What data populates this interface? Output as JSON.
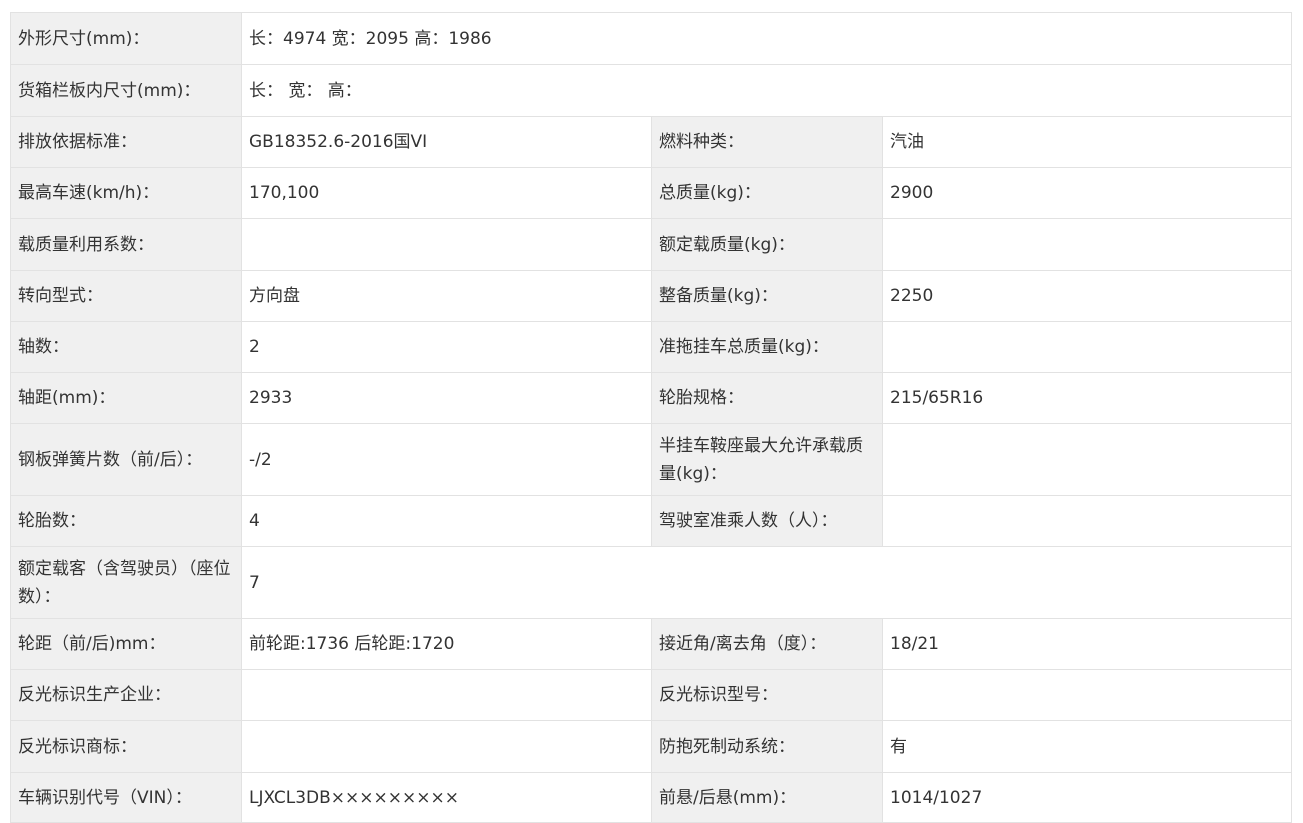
{
  "rows": [
    {
      "type": "wide",
      "label": "外形尺寸(mm)：",
      "value": "长：4974 宽：2095 高：1986"
    },
    {
      "type": "wide",
      "label": "货箱栏板内尺寸(mm)：",
      "value": "长： 宽： 高："
    },
    {
      "type": "pair",
      "label1": "排放依据标准：",
      "value1": "GB18352.6-2016国VI",
      "label2": "燃料种类：",
      "value2": "汽油"
    },
    {
      "type": "pair",
      "label1": "最高车速(km/h)：",
      "value1": "170,100",
      "label2": "总质量(kg)：",
      "value2": "2900"
    },
    {
      "type": "pair",
      "label1": "载质量利用系数：",
      "value1": "",
      "label2": "额定载质量(kg)：",
      "value2": ""
    },
    {
      "type": "pair",
      "label1": "转向型式：",
      "value1": "方向盘",
      "label2": "整备质量(kg)：",
      "value2": "2250"
    },
    {
      "type": "pair",
      "label1": "轴数：",
      "value1": "2",
      "label2": "准拖挂车总质量(kg)：",
      "value2": ""
    },
    {
      "type": "pair",
      "label1": "轴距(mm)：",
      "value1": "2933",
      "label2": "轮胎规格：",
      "value2": "215/65R16"
    },
    {
      "type": "pair",
      "tall": true,
      "label1": "钢板弹簧片数（前/后）：",
      "value1": "-/2",
      "label2": "半挂车鞍座最大允许承载质量(kg)：",
      "value2": ""
    },
    {
      "type": "pair",
      "label1": "轮胎数：",
      "value1": "4",
      "label2": "驾驶室准乘人数（人）：",
      "value2": ""
    },
    {
      "type": "wide",
      "tall": true,
      "label": "额定载客（含驾驶员）（座位数）：",
      "value": "7"
    },
    {
      "type": "pair",
      "label1": "轮距（前/后)mm：",
      "value1": "前轮距:1736 后轮距:1720",
      "label2": "接近角/离去角（度）：",
      "value2": "18/21"
    },
    {
      "type": "pair",
      "label1": "反光标识生产企业：",
      "value1": "",
      "label2": "反光标识型号：",
      "value2": ""
    },
    {
      "type": "pair",
      "label1": "反光标识商标：",
      "value1": "",
      "label2": "防抱死制动系统：",
      "value2": "有"
    },
    {
      "type": "pair",
      "label1": "车辆识别代号（VIN）：",
      "value1": "LJXCL3DB×××××××××",
      "label2": "前悬/后悬(mm)：",
      "value2": "1014/1027"
    }
  ]
}
